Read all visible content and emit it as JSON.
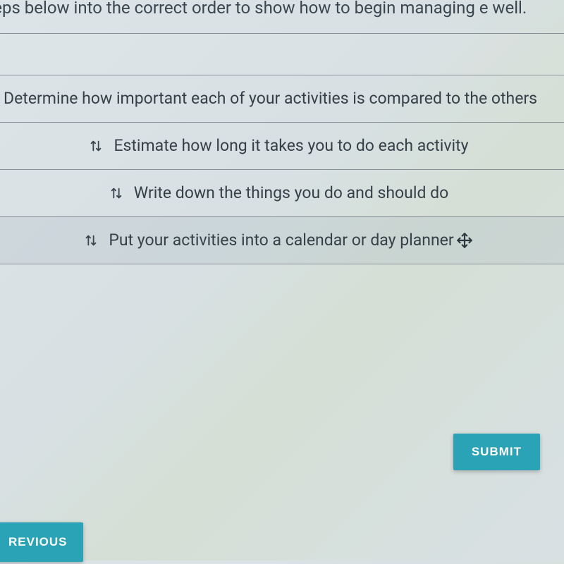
{
  "instructions": "steps below into the correct order to show how to begin managing e well.",
  "items": [
    "Determine how important each of your activities is compared to the others",
    "Estimate how long it takes you to do each activity",
    "Write down the things you do and should do",
    "Put your activities into a calendar or day planner"
  ],
  "buttons": {
    "submit": "SUBMIT",
    "previous": "REVIOUS"
  }
}
